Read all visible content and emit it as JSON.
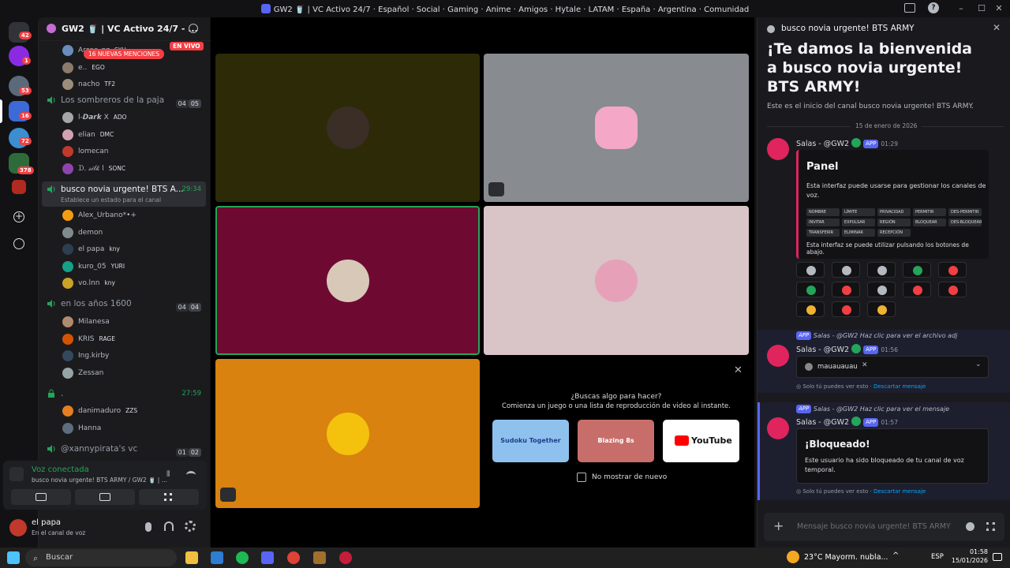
{
  "window": {
    "title": "GW2 🥤 | VC Activo 24/7 · Español · Social · Gaming · Anime · Amigos · Hytale · LATAM · España · Argentina · Comunidad"
  },
  "servers": {
    "badges": [
      "42",
      "1",
      "53",
      "16",
      "72",
      "378"
    ]
  },
  "server": {
    "name": "GW2 🥤 | VC Activo 24/7 - ...",
    "live": "EN VIVO",
    "mentions": "16 NUEVAS MENCIONES"
  },
  "channels": [
    {
      "name": "Los sombreros de la paja",
      "count": [
        "04",
        "05"
      ]
    },
    {
      "name": "busco novia urgente! BTS A...",
      "timer": "29:34",
      "status": "Establece un estado para el canal"
    },
    {
      "name": "en los años 1600",
      "count": [
        "04",
        "04"
      ]
    },
    {
      "name": ".",
      "timer": "27:59"
    },
    {
      "name": "@xannypirata's vc",
      "count": [
        "01",
        "02"
      ]
    }
  ],
  "users_top": [
    {
      "name": "Arsac_nz",
      "tag": "SYH"
    },
    {
      "name": "e..",
      "tag": "EGO"
    },
    {
      "name": "nacho",
      "tag": "TF2"
    }
  ],
  "users_sombreros": [
    {
      "name": "l-𝘿𝙖𝙧𝙠 X",
      "tag": "ADO"
    },
    {
      "name": "elian",
      "tag": "DMC"
    },
    {
      "name": "lomecan",
      "tag": ""
    },
    {
      "name": "ᗪ. 𝓈𝒾𝓁𝓀 l",
      "tag": "SONC"
    }
  ],
  "users_busco": [
    {
      "name": "Alex_Urbano*•+",
      "tag": ""
    },
    {
      "name": "demon",
      "tag": ""
    },
    {
      "name": "el papa",
      "tag": "kny"
    },
    {
      "name": "kuro_05",
      "tag": "YURI"
    },
    {
      "name": "vo.lnn",
      "tag": "kny"
    }
  ],
  "users_1600": [
    {
      "name": "Milanesa",
      "tag": ""
    },
    {
      "name": "KRIS",
      "tag": "RAGE"
    },
    {
      "name": "Ing.kirby",
      "tag": ""
    },
    {
      "name": "Zessan",
      "tag": ""
    }
  ],
  "users_dot": [
    {
      "name": "danimaduro",
      "tag": "ZZS"
    },
    {
      "name": "Hanna",
      "tag": ""
    }
  ],
  "voice": {
    "title": "Voz conectada",
    "sub": "busco novia urgente! BTS ARMY / GW2 🥤 | ..."
  },
  "me": {
    "name": "el papa",
    "status": "En el canal de voz"
  },
  "activity": {
    "q": "¿Buscas algo para hacer?",
    "sub": "Comienza un juego o una lista de reproducción de video al instante.",
    "games": [
      "Sudoku Together",
      "Blazing 8s",
      "YouTube"
    ],
    "checkbox": "No mostrar de nuevo"
  },
  "chat": {
    "header": "busco novia urgente! BTS ARMY",
    "welcome": "¡Te damos la bienvenida a busco novia urgente! BTS ARMY!",
    "intro": "Este es el inicio del canal busco novia urgente!  BTS ARMY.",
    "date": "15 de enero de 2026",
    "bot": "Salas - @GW2",
    "app": "APP",
    "t1": "01:29",
    "t2": "01:56",
    "t3": "01:57",
    "panel_title": "Panel",
    "panel_desc": "Esta interfaz puede usarse para gestionar los canales de voz.",
    "panel_tags": [
      "NOMBRE",
      "LÍMITE",
      "PRIVACIDAD",
      "PERMITIR",
      "DES-PERMITIR",
      "INVITAR",
      "EXPULSAR",
      "REGIÓN",
      "BLOQUEAR",
      "DES-BLOQUEAR",
      "TRANSFERIR",
      "ELIMINAR",
      "RECEPCIÓN"
    ],
    "panel_foot": "Esta interfaz se puede utilizar pulsando los botones de abajo.",
    "reply1": "Salas - @GW2 Haz clic para ver el archivo adj",
    "select_value": "mauauauau",
    "only_you": "Solo tú puedes ver esto",
    "dismiss": "Descartar mensaje",
    "reply2": "Salas - @GW2 Haz clic para ver el mensaje",
    "blocked_title": "¡Bloqueado!",
    "blocked_desc": "Este usuario ha sido bloqueado de tu canal de voz temporal.",
    "input_placeholder": "Mensaje busco novia urgente! BTS ARMY"
  },
  "taskbar": {
    "search": "Buscar",
    "weather": "23°C  Mayorm. nubla...",
    "lang": "ESP",
    "time": "01:58",
    "date": "15/01/2026"
  },
  "colors": {
    "accent": "#5865f2",
    "green": "#23a55a",
    "red": "#f23f43"
  }
}
